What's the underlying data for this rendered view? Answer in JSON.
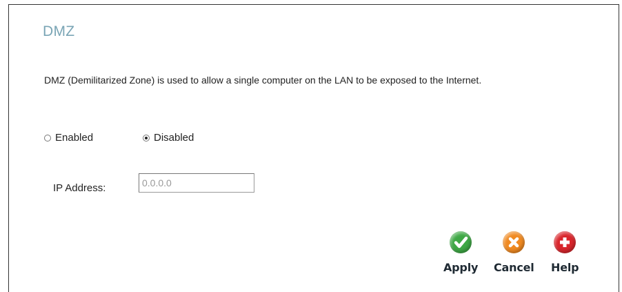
{
  "page": {
    "title": "DMZ",
    "description": "DMZ (Demilitarized Zone) is used to allow a single computer on the LAN to be exposed to the Internet."
  },
  "dmz_mode": {
    "options": [
      {
        "label": "Enabled",
        "checked": false
      },
      {
        "label": "Disabled",
        "checked": true
      }
    ]
  },
  "ip_address": {
    "label": "IP Address:",
    "value": "0.0.0.0"
  },
  "buttons": {
    "apply": {
      "label": "Apply",
      "icon": "check-icon",
      "color": "#3ea845"
    },
    "cancel": {
      "label": "Cancel",
      "icon": "x-icon",
      "color": "#f08a22"
    },
    "help": {
      "label": "Help",
      "icon": "plus-icon",
      "color": "#d9262c"
    }
  }
}
